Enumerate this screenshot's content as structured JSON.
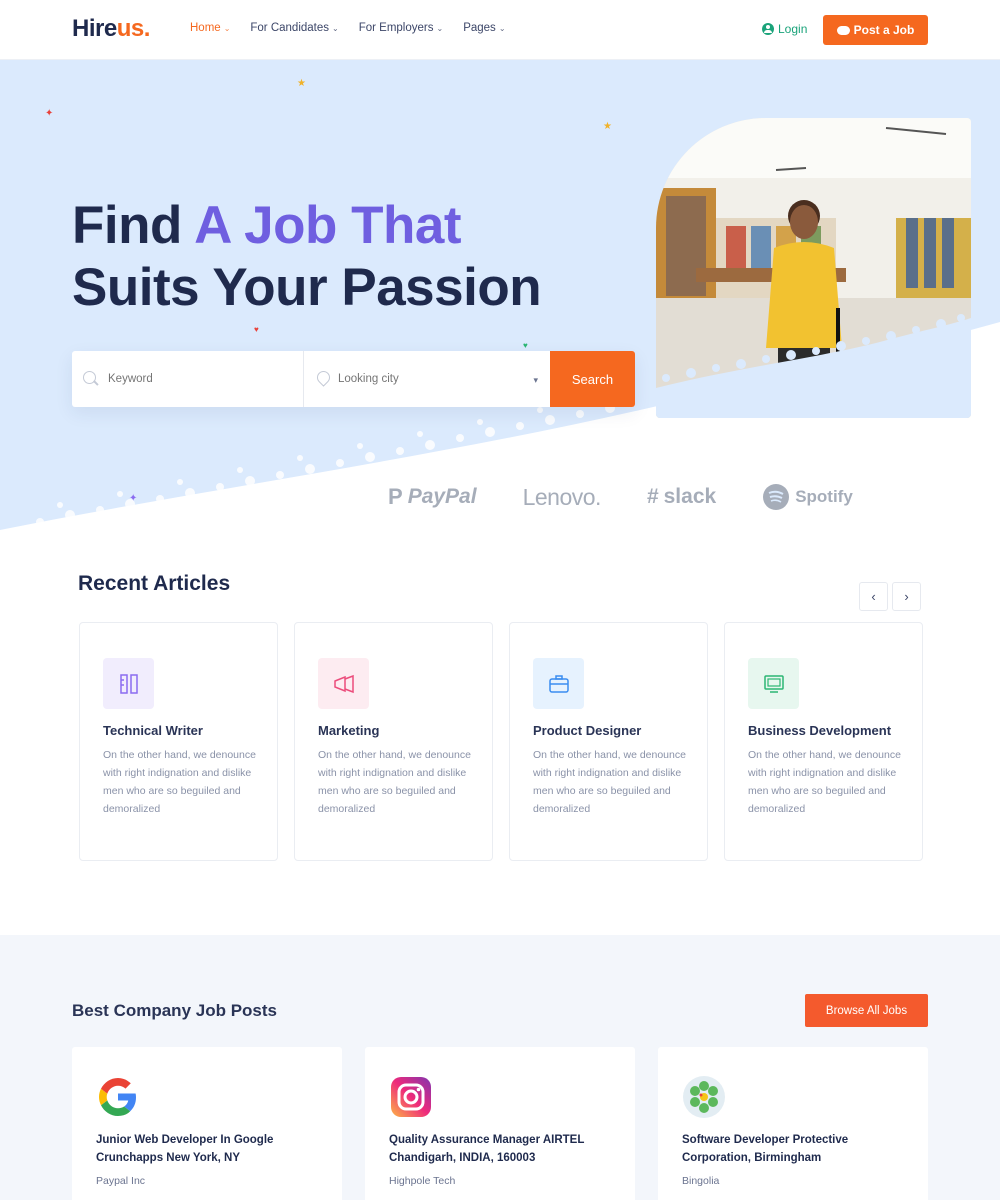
{
  "header": {
    "logo_main": "Hire",
    "logo_accent": "us.",
    "nav": [
      {
        "label": "Home",
        "active": true
      },
      {
        "label": "For Candidates",
        "active": false
      },
      {
        "label": "For Employers",
        "active": false
      },
      {
        "label": "Pages",
        "active": false
      }
    ],
    "login_label": "Login",
    "post_job_label": "Post a Job"
  },
  "hero": {
    "title_part1": "Find ",
    "title_highlight": "A Job That",
    "title_line2": "Suits Your Passion",
    "keyword_placeholder": "Keyword",
    "city_placeholder": "Looking city",
    "search_label": "Search",
    "brands": [
      "PayPal",
      "Lenovo.",
      "slack",
      "Spotify"
    ]
  },
  "articles": {
    "title": "Recent Articles",
    "items": [
      {
        "title": "Technical Writer",
        "text": "On the other hand, we denounce with right indignation and dislike men who are so beguiled and demoralized",
        "icon": "ruler-pencil-icon",
        "color": "#8b6cf0",
        "bg": "#f1edfd"
      },
      {
        "title": "Marketing",
        "text": "On the other hand, we denounce with right indignation and dislike men who are so beguiled and demoralized",
        "icon": "megaphone-icon",
        "color": "#ec4d7c",
        "bg": "#fdecf1"
      },
      {
        "title": "Product Designer",
        "text": "On the other hand, we denounce with right indignation and dislike men who are so beguiled and demoralized",
        "icon": "briefcase-icon",
        "color": "#3a8df0",
        "bg": "#e6f2fe"
      },
      {
        "title": "Business Development",
        "text": "On the other hand, we denounce with right indignation and dislike men who are so beguiled and demoralized",
        "icon": "monitor-icon",
        "color": "#2bb673",
        "bg": "#e7f7ef"
      }
    ]
  },
  "jobs": {
    "title": "Best Company Job Posts",
    "browse_label": "Browse All Jobs",
    "items": [
      {
        "title": "Junior Web Developer In Google Crunchapps New York, NY",
        "company": "Paypal Inc",
        "logo": "google-logo"
      },
      {
        "title": "Quality Assurance Manager AIRTEL Chandigarh, INDIA, 160003",
        "company": "Highpole Tech",
        "logo": "instagram-logo"
      },
      {
        "title": "Software Developer Protective Corporation, Birmingham",
        "company": "Bingolia",
        "logo": "flower-logo"
      }
    ]
  },
  "colors": {
    "accent": "#f5681f",
    "highlight": "#6f5fe0",
    "text": "#1f2a4d",
    "hero_bg": "#dbeafd"
  }
}
